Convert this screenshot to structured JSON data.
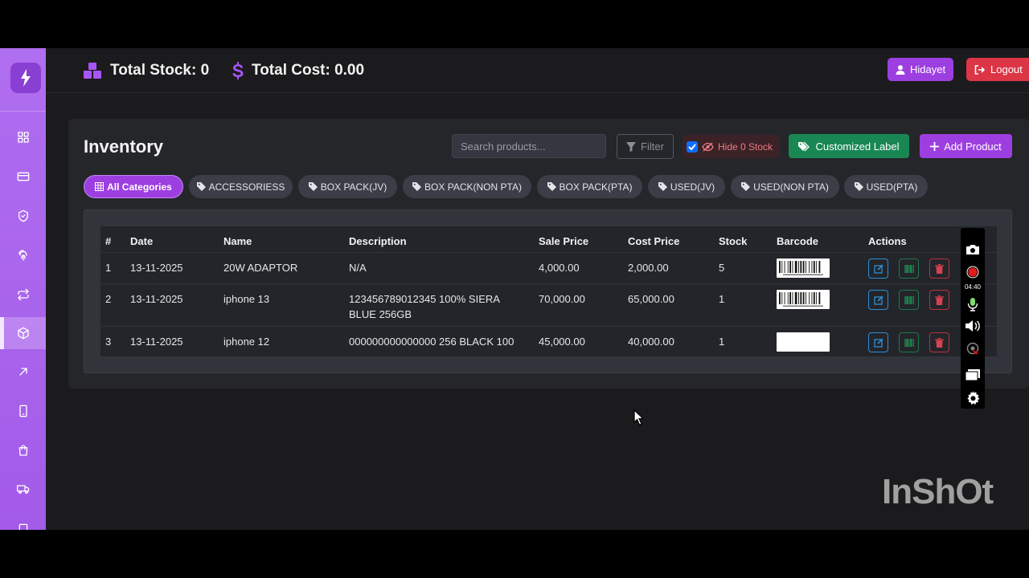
{
  "header": {
    "total_stock": "Total Stock: 0",
    "total_cost": "Total Cost: 0.00",
    "user_label": "Hidayet",
    "logout_label": "Logout"
  },
  "sidebar": {
    "items": [
      "dashboard",
      "cards",
      "shield",
      "fingerprint",
      "transfer",
      "inventory",
      "outgoing",
      "mobile",
      "shopping-bag",
      "delivery",
      "page"
    ],
    "active": "inventory"
  },
  "inventory": {
    "title": "Inventory",
    "search_placeholder": "Search products...",
    "filter_label": "Filter",
    "hide_zero_label": "Hide 0 Stock",
    "hide_zero_checked": true,
    "customized_label": "Customized Label",
    "add_product_label": "Add Product",
    "categories": [
      "All Categories",
      "ACCESSORIESS",
      "BOX PACK(JV)",
      "BOX PACK(NON PTA)",
      "BOX PACK(PTA)",
      "USED(JV)",
      "USED(NON PTA)",
      "USED(PTA)"
    ],
    "active_category": "All Categories",
    "columns": [
      "#",
      "Date",
      "Name",
      "Description",
      "Sale Price",
      "Cost Price",
      "Stock",
      "Barcode",
      "Actions"
    ],
    "rows": [
      {
        "num": "1",
        "date": "13-11-2025",
        "name": "20W ADAPTOR",
        "description": "N/A",
        "description2": "",
        "sale": "4,000.00",
        "cost": "2,000.00",
        "stock": "5",
        "barcode": true
      },
      {
        "num": "2",
        "date": "13-11-2025",
        "name": "iphone 13",
        "description": "123456789012345 100% SIERA",
        "description2": "BLUE 256GB",
        "sale": "70,000.00",
        "cost": "65,000.00",
        "stock": "1",
        "barcode": true
      },
      {
        "num": "3",
        "date": "13-11-2025",
        "name": "iphone 12",
        "description": "000000000000000 256 BLACK 100",
        "description2": "",
        "sale": "45,000.00",
        "cost": "40,000.00",
        "stock": "1",
        "barcode": false
      }
    ]
  },
  "recorder": {
    "time": "04:40",
    "icons": [
      "camera-icon",
      "record-icon",
      "microphone-icon",
      "speaker-icon",
      "webcam-icon",
      "screen-icon",
      "settings-icon"
    ]
  },
  "watermark": "InShOt",
  "colors": {
    "accent": "#9d3fe0",
    "sidebar": "#a35be8",
    "danger": "#dc3545",
    "success": "#198754",
    "panel": "#25262a"
  }
}
